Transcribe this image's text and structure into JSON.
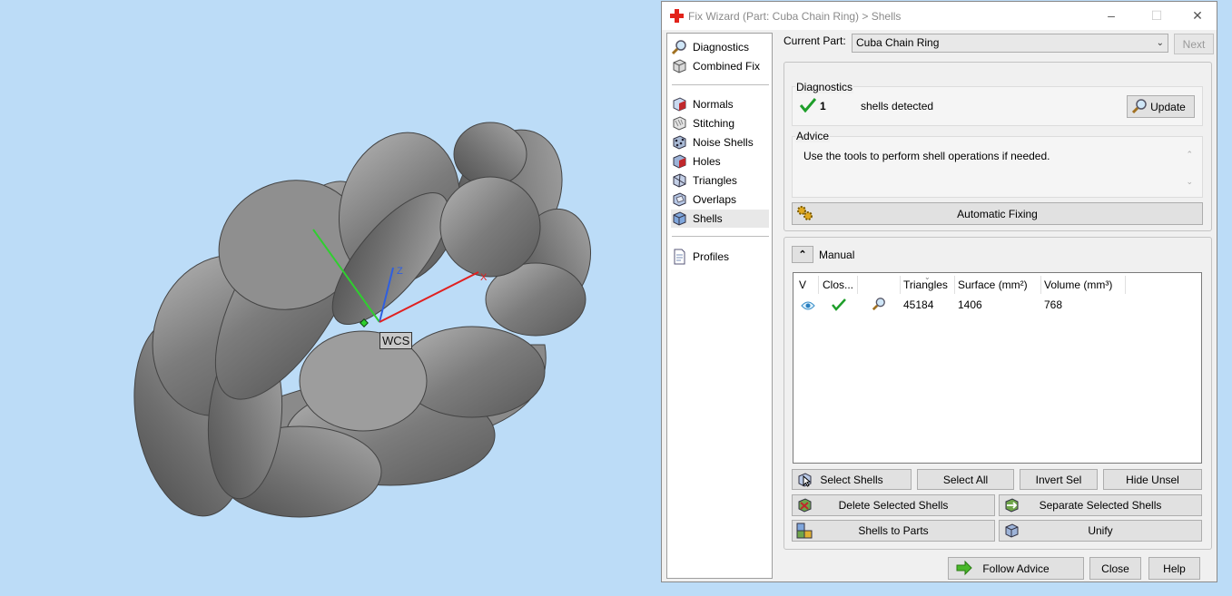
{
  "viewport": {
    "wcs_label": "WCS",
    "axis_z": "Z",
    "axis_x": "X"
  },
  "window": {
    "title": "Fix Wizard (Part: Cuba Chain Ring) > Shells"
  },
  "nav": {
    "top": [
      "Diagnostics",
      "Combined Fix"
    ],
    "tools": [
      "Normals",
      "Stitching",
      "Noise Shells",
      "Holes",
      "Triangles",
      "Overlaps",
      "Shells"
    ],
    "bottom": [
      "Profiles"
    ],
    "active": "Shells"
  },
  "current_part": {
    "label": "Current Part:",
    "value": "Cuba Chain Ring",
    "next_label": "Next"
  },
  "diagnostics": {
    "legend": "Diagnostics",
    "count": "1",
    "text": "shells detected",
    "update_label": "Update"
  },
  "advice": {
    "legend": "Advice",
    "text": "Use the tools to perform shell operations if needed."
  },
  "automatic_fixing_label": "Automatic Fixing",
  "manual": {
    "title": "Manual",
    "columns": [
      "V",
      "Clos...",
      "",
      "Triangles",
      "Surface (mm²)",
      "Volume (mm³)"
    ],
    "rows": [
      {
        "triangles": "45184",
        "surface": "1406",
        "volume": "768"
      }
    ]
  },
  "actions": {
    "select_shells": "Select Shells",
    "select_all": "Select All",
    "invert_sel": "Invert Sel",
    "hide_unsel": "Hide Unsel",
    "delete_selected": "Delete Selected Shells",
    "separate_selected": "Separate Selected Shells",
    "shells_to_parts": "Shells to Parts",
    "unify": "Unify"
  },
  "footer": {
    "follow_advice": "Follow Advice",
    "close": "Close",
    "help": "Help"
  },
  "colors": {
    "viewport_bg": "#bcdcf7",
    "check": "#1e9e2a",
    "accent_red": "#e2231a"
  }
}
